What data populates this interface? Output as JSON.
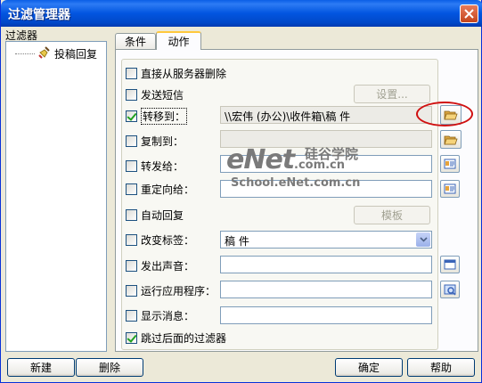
{
  "window": {
    "title": "过滤管理器"
  },
  "sidebar": {
    "label": "过滤器",
    "items": [
      {
        "label": "投稿回复"
      }
    ]
  },
  "tabs": [
    {
      "label": "条件",
      "active": false
    },
    {
      "label": "动作",
      "active": true
    }
  ],
  "actions": {
    "delete_from_server": {
      "label": "直接从服务器删除",
      "checked": false
    },
    "send_sms": {
      "label": "发送短信",
      "checked": false,
      "button": "设置..."
    },
    "move_to": {
      "label": "转移到：",
      "checked": true,
      "value": "\\\\宏伟 (办公)\\收件箱\\稿 件"
    },
    "copy_to": {
      "label": "复制到：",
      "checked": false,
      "value": ""
    },
    "forward_to": {
      "label": "转发给：",
      "checked": false,
      "value": ""
    },
    "redirect_to": {
      "label": "重定向给：",
      "checked": false,
      "value": ""
    },
    "auto_reply": {
      "label": "自动回复",
      "checked": false,
      "button": "模板"
    },
    "change_tag": {
      "label": "改变标签：",
      "checked": false,
      "value": "稿   件"
    },
    "play_sound": {
      "label": "发出声音：",
      "checked": false,
      "value": ""
    },
    "run_app": {
      "label": "运行应用程序：",
      "checked": false,
      "value": ""
    },
    "show_message": {
      "label": "显示消息：",
      "checked": false,
      "value": ""
    },
    "skip_filters": {
      "label": "跳过后面的过滤器",
      "checked": true
    }
  },
  "footer": {
    "new": "新建",
    "delete": "删除",
    "ok": "确定",
    "help": "帮助"
  },
  "watermark": {
    "logo": "eNet",
    "cn": "硅谷学院",
    "com": ".com.cn",
    "url": "School.eNet.com.cn"
  },
  "colors": {
    "titlebar": "#0255e0",
    "highlight": "#d01010",
    "check": "#21a121"
  }
}
